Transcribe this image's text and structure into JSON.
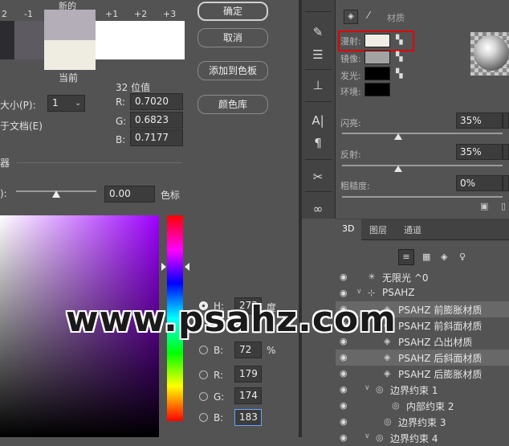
{
  "picker": {
    "scale_labels": [
      "2",
      "-1",
      "+1",
      "+2",
      "+3"
    ],
    "new_label": "新的",
    "current_label": "当前",
    "colors": {
      "new_swatch": "#b3aeb7",
      "current_swatch": "#efece2",
      "left_dark1": "#2c2c2e",
      "left_dark2": "#3d3c40",
      "mid_swatch": "#5d5a62",
      "light_swatch": "#ffffff"
    },
    "buttons": {
      "ok": "确定",
      "cancel": "取消",
      "add_to_swatches": "添加到色板",
      "color_libraries": "颜色库"
    },
    "bit_label": "32 位值",
    "size_label": "大小(P):",
    "size_value": "1",
    "doc_label": "于文档(E)",
    "float_r_label": "R:",
    "float_r": "0.7020",
    "float_g_label": "G:",
    "float_g": "0.6823",
    "float_b_label": "B:",
    "float_b": "0.7177",
    "section_label": "器",
    "exposure_prefix": "):",
    "exposure_value": "0.00",
    "exposure_unit": "色标",
    "hsb": {
      "h_label": "H:",
      "h_value": "273",
      "h_unit": "度",
      "s_label": "S:",
      "b_label": "B:",
      "b_value": "72",
      "b_unit": "%"
    },
    "rgb": {
      "r_label": "R:",
      "r_value": "179",
      "g_label": "G:",
      "g_value": "174",
      "b_label": "B:",
      "b_value": "183"
    }
  },
  "properties": {
    "tab_label": "材质",
    "materials": [
      {
        "label": "漫射:",
        "color": "#f0ede4"
      },
      {
        "label": "镜像:",
        "color": "#a3a3a3"
      },
      {
        "label": "发光:",
        "color": "#000000"
      },
      {
        "label": "环境:",
        "color": "#000000"
      }
    ],
    "sliders": [
      {
        "label": "闪亮:",
        "value": "35%",
        "fraction": 0.35
      },
      {
        "label": "反射:",
        "value": "35%",
        "fraction": 0.35
      },
      {
        "label": "粗糙度:",
        "value": "0%",
        "fraction": 0.0
      }
    ]
  },
  "panel3d": {
    "tabs": [
      "3D",
      "图层",
      "通道"
    ],
    "rows": [
      {
        "text": "无限光 ^0",
        "indent": 0,
        "icon": "light-icon",
        "selected": false
      },
      {
        "text": "PSAHZ",
        "indent": 0,
        "icon": "mesh-icon",
        "selected": false
      },
      {
        "text": "PSAHZ 前膨胀材质",
        "indent": 2,
        "icon": "material-icon",
        "selected": true
      },
      {
        "text": "PSAHZ 前斜面材质",
        "indent": 2,
        "icon": "material-icon",
        "selected": false
      },
      {
        "text": "PSAHZ 凸出材质",
        "indent": 2,
        "icon": "material-icon",
        "selected": false
      },
      {
        "text": "PSAHZ 后斜面材质",
        "indent": 2,
        "icon": "material-icon",
        "selected": true
      },
      {
        "text": "PSAHZ 后膨胀材质",
        "indent": 2,
        "icon": "material-icon",
        "selected": false
      },
      {
        "text": "边界约束 1",
        "indent": 1,
        "icon": "constraint-icon",
        "selected": false
      },
      {
        "text": "内部约束 2",
        "indent": 3,
        "icon": "constraint-icon",
        "selected": false
      },
      {
        "text": "边界约束 3",
        "indent": 2,
        "icon": "constraint-icon",
        "selected": false
      },
      {
        "text": "边界约束 4",
        "indent": 1,
        "icon": "constraint-icon",
        "selected": false
      }
    ]
  },
  "watermark": "www.psahz.com"
}
